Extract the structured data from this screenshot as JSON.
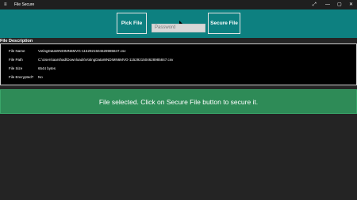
{
  "window": {
    "menu_icon": "≡",
    "title": "File Secure",
    "controls": {
      "expand": "⤢",
      "minimize": "—",
      "maximize": "▢",
      "close": "✕"
    }
  },
  "toolbar": {
    "pick_label": "Pick File",
    "arrow_icon": "right-arrow-icon",
    "password_placeholder": "Password",
    "secure_label": "Secure File"
  },
  "file_description": {
    "title": "File Description",
    "rows": [
      {
        "label": "File Name",
        "value": "VotingDataWNDIMN6MVG-1152921504628985847.csv"
      },
      {
        "label": "File Path",
        "value": "C:\\Users\\aarshad\\Downloads\\VotingDataWNDIMN6MVG-1152921504628985847.csv"
      },
      {
        "label": "File Size",
        "value": "6544 bytes"
      },
      {
        "label": "File Encrypted?",
        "value": "No"
      }
    ]
  },
  "status": {
    "message": "File selected. Click on Secure File button to secure it."
  },
  "colors": {
    "teal": "#0d8080",
    "green": "#2e8b57",
    "background": "#242424"
  }
}
